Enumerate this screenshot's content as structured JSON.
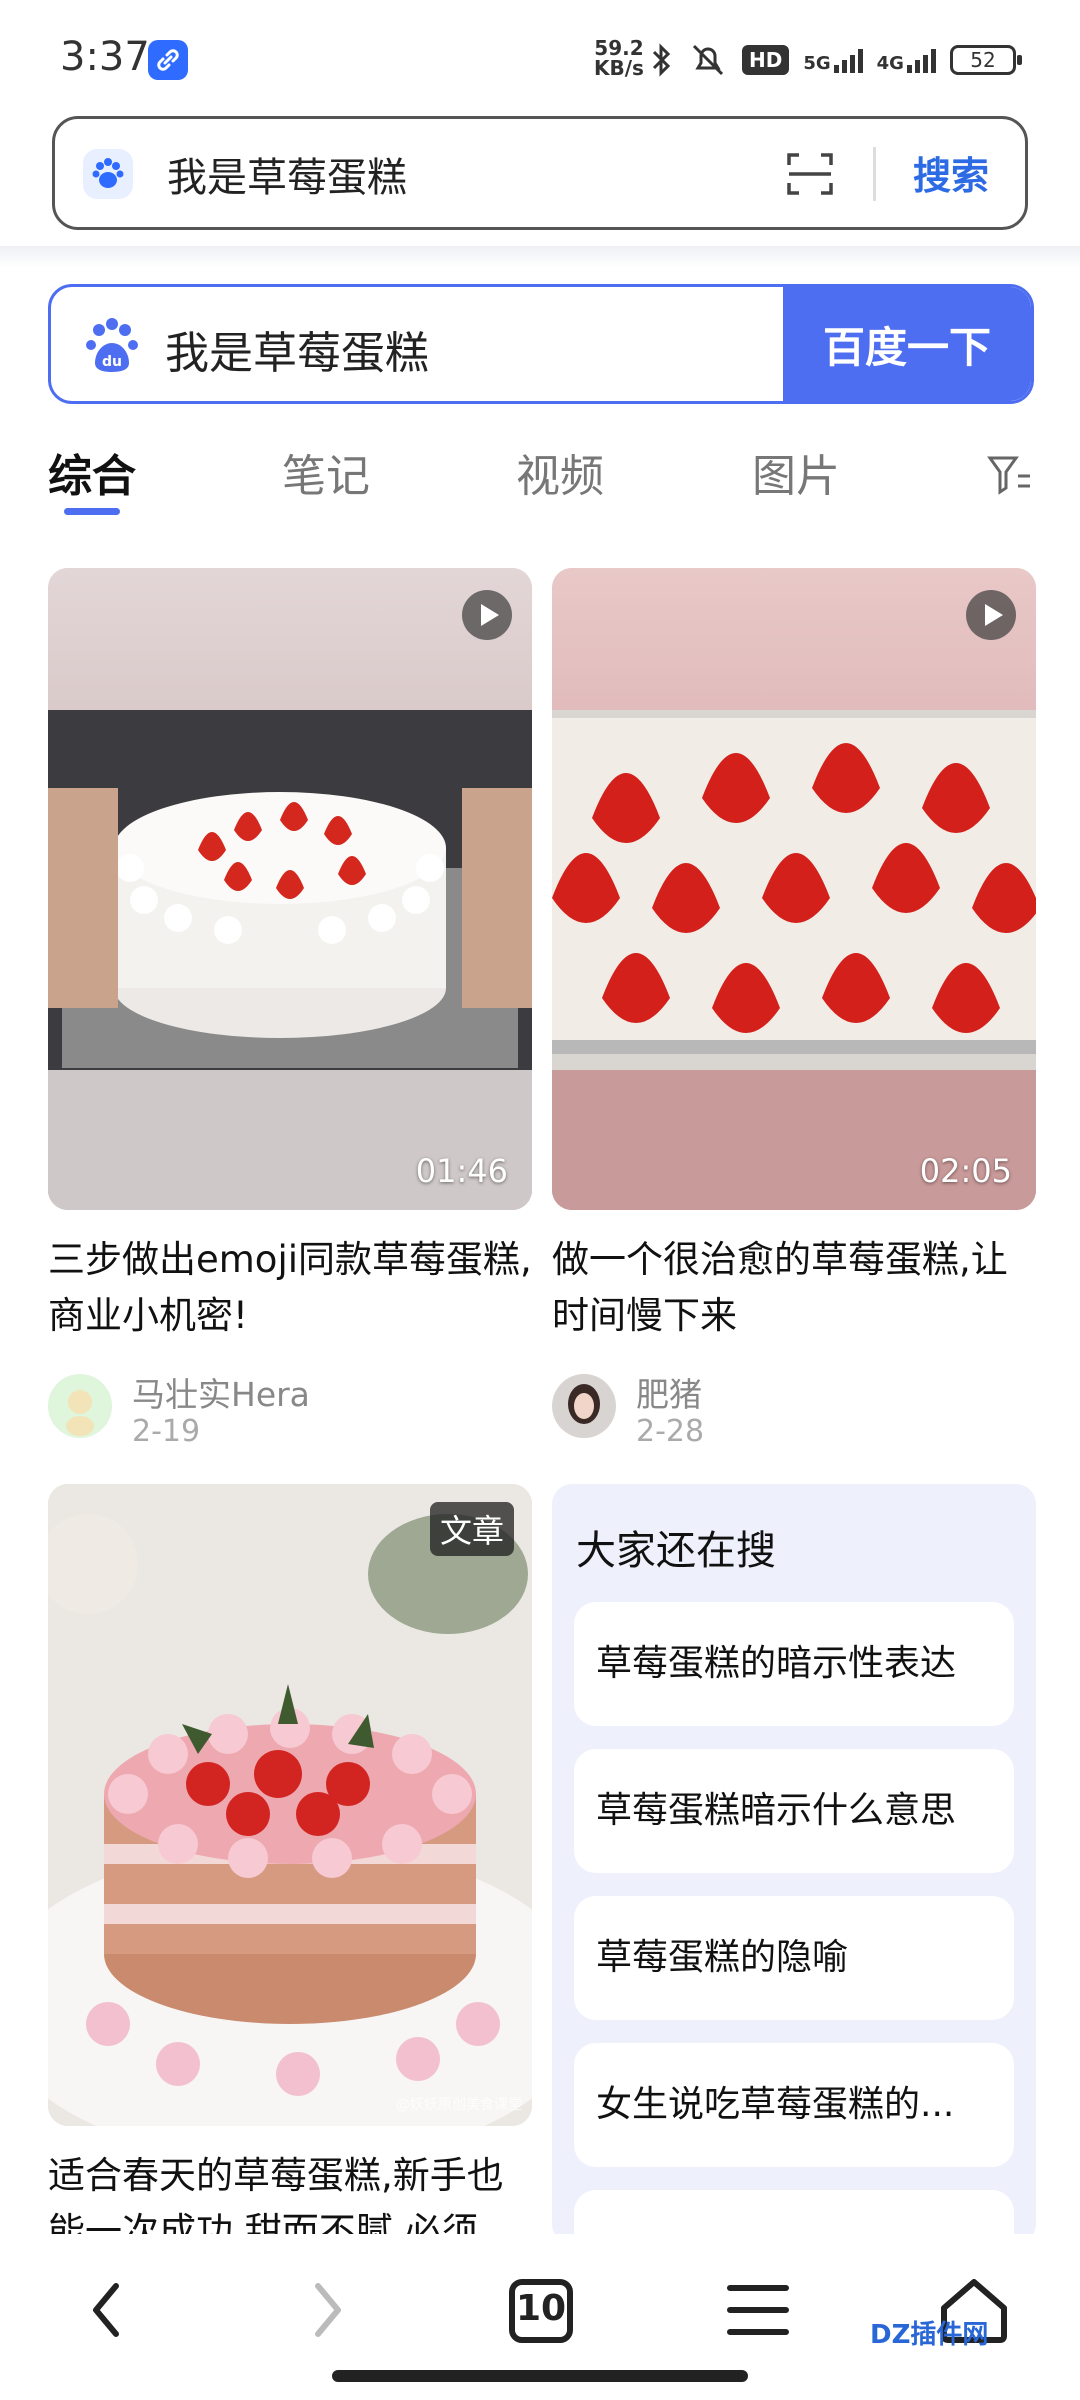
{
  "status": {
    "time": "3:37",
    "netspeed_top": "59.2",
    "netspeed_unit": "KB/s",
    "hd": "HD",
    "net1": "5G",
    "net2": "4G",
    "battery": "52"
  },
  "top_search": {
    "query": "我是草莓蛋糕",
    "button": "搜索"
  },
  "baidu_search": {
    "query": "我是草莓蛋糕",
    "button": "百度一下"
  },
  "tabs": [
    "综合",
    "笔记",
    "视频",
    "图片"
  ],
  "cards": [
    {
      "title": "三步做出emoji同款草莓蛋糕,商业小机密!",
      "duration": "01:46",
      "author": "马壮实Hera",
      "date": "2-19"
    },
    {
      "title": "做一个很治愈的草莓蛋糕,让时间慢下来",
      "duration": "02:05",
      "author": "肥猪",
      "date": "2-28"
    },
    {
      "title": "适合春天的草莓蛋糕,新手也能一次成功,甜而不腻,必须",
      "tag": "文章",
      "watermark": "@妖妖原创美食课堂"
    }
  ],
  "related": {
    "title": "大家还在搜",
    "items": [
      "草莓蛋糕的暗示性表达",
      "草莓蛋糕暗示什么意思",
      "草莓蛋糕的隐喻",
      "女生说吃草莓蛋糕的..."
    ]
  },
  "nav": {
    "tabs_count": "10"
  },
  "watermark_site": "DZ插件网",
  "colors": {
    "accent": "#4e6ef2",
    "link_blue": "#2d6be4"
  }
}
